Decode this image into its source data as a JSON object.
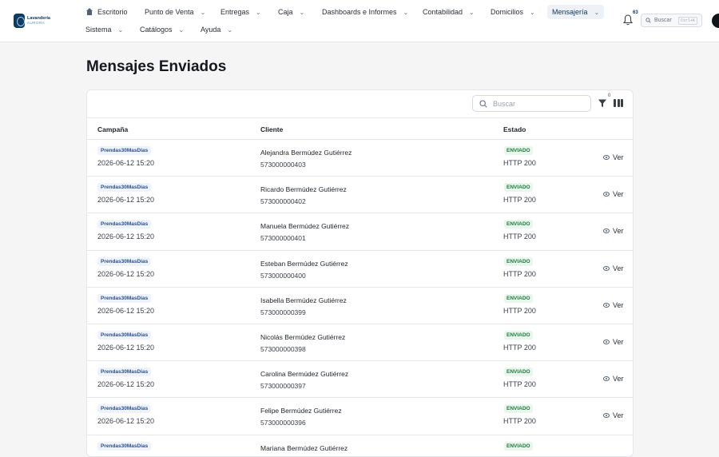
{
  "app": {
    "logo_line1": "Lavandería",
    "logo_line2": "AURORA"
  },
  "nav": {
    "row1": [
      {
        "label": "Escritorio",
        "icon": "home-icon",
        "dropdown": false
      },
      {
        "label": "Punto de Venta",
        "dropdown": true
      },
      {
        "label": "Entregas",
        "dropdown": true
      },
      {
        "label": "Caja",
        "dropdown": true
      },
      {
        "label": "Dashboards e Informes",
        "dropdown": true
      },
      {
        "label": "Contabilidad",
        "dropdown": true
      },
      {
        "label": "Domicilios",
        "dropdown": true
      },
      {
        "label": "Mensajería",
        "dropdown": true,
        "active": true
      }
    ],
    "row2": [
      {
        "label": "Sistema",
        "dropdown": true
      },
      {
        "label": "Catálogos",
        "dropdown": true
      },
      {
        "label": "Ayuda",
        "dropdown": true
      }
    ]
  },
  "notifications": {
    "icon": "bell-icon",
    "count": "63"
  },
  "global_search": {
    "placeholder": "Buscar",
    "shortcut": "Ctrl+K"
  },
  "page": {
    "title": "Mensajes Enviados"
  },
  "table": {
    "search_placeholder": "Buscar",
    "filter_count": "0",
    "columns": {
      "campaign": "Campaña",
      "client": "Cliente",
      "status": "Estado"
    },
    "rows": [
      {
        "campaign": "Prendas30MasDias",
        "date": "2026-06-12 15:20",
        "name": "Alejandra Bermúdez Gutiérrez",
        "phone": "573000000403",
        "status": "ENVIADO",
        "http": "HTTP 200",
        "action": "Ver"
      },
      {
        "campaign": "Prendas30MasDias",
        "date": "2026-06-12 15:20",
        "name": "Ricardo Bermúdez Gutiérrez",
        "phone": "573000000402",
        "status": "ENVIADO",
        "http": "HTTP 200",
        "action": "Ver"
      },
      {
        "campaign": "Prendas30MasDias",
        "date": "2026-06-12 15:20",
        "name": "Manuela Bermúdez Gutiérrez",
        "phone": "573000000401",
        "status": "ENVIADO",
        "http": "HTTP 200",
        "action": "Ver"
      },
      {
        "campaign": "Prendas30MasDias",
        "date": "2026-06-12 15:20",
        "name": "Esteban Bermúdez Gutiérrez",
        "phone": "573000000400",
        "status": "ENVIADO",
        "http": "HTTP 200",
        "action": "Ver"
      },
      {
        "campaign": "Prendas30MasDias",
        "date": "2026-06-12 15:20",
        "name": "Isabella Bermúdez Gutiérrez",
        "phone": "573000000399",
        "status": "ENVIADO",
        "http": "HTTP 200",
        "action": "Ver"
      },
      {
        "campaign": "Prendas30MasDias",
        "date": "2026-06-12 15:20",
        "name": "Nicolás Bermúdez Gutiérrez",
        "phone": "573000000398",
        "status": "ENVIADO",
        "http": "HTTP 200",
        "action": "Ver"
      },
      {
        "campaign": "Prendas30MasDias",
        "date": "2026-06-12 15:20",
        "name": "Carolina Bermúdez Gutiérrez",
        "phone": "573000000397",
        "status": "ENVIADO",
        "http": "HTTP 200",
        "action": "Ver"
      },
      {
        "campaign": "Prendas30MasDias",
        "date": "2026-06-12 15:20",
        "name": "Felipe Bermúdez Gutiérrez",
        "phone": "573000000396",
        "status": "ENVIADO",
        "http": "HTTP 200",
        "action": "Ver"
      },
      {
        "campaign": "Prendas30MasDias",
        "date": "",
        "name": "Mariana Bermúdez Gutiérrez",
        "phone": "",
        "status": "ENVIADO",
        "http": "",
        "action": ""
      }
    ]
  }
}
